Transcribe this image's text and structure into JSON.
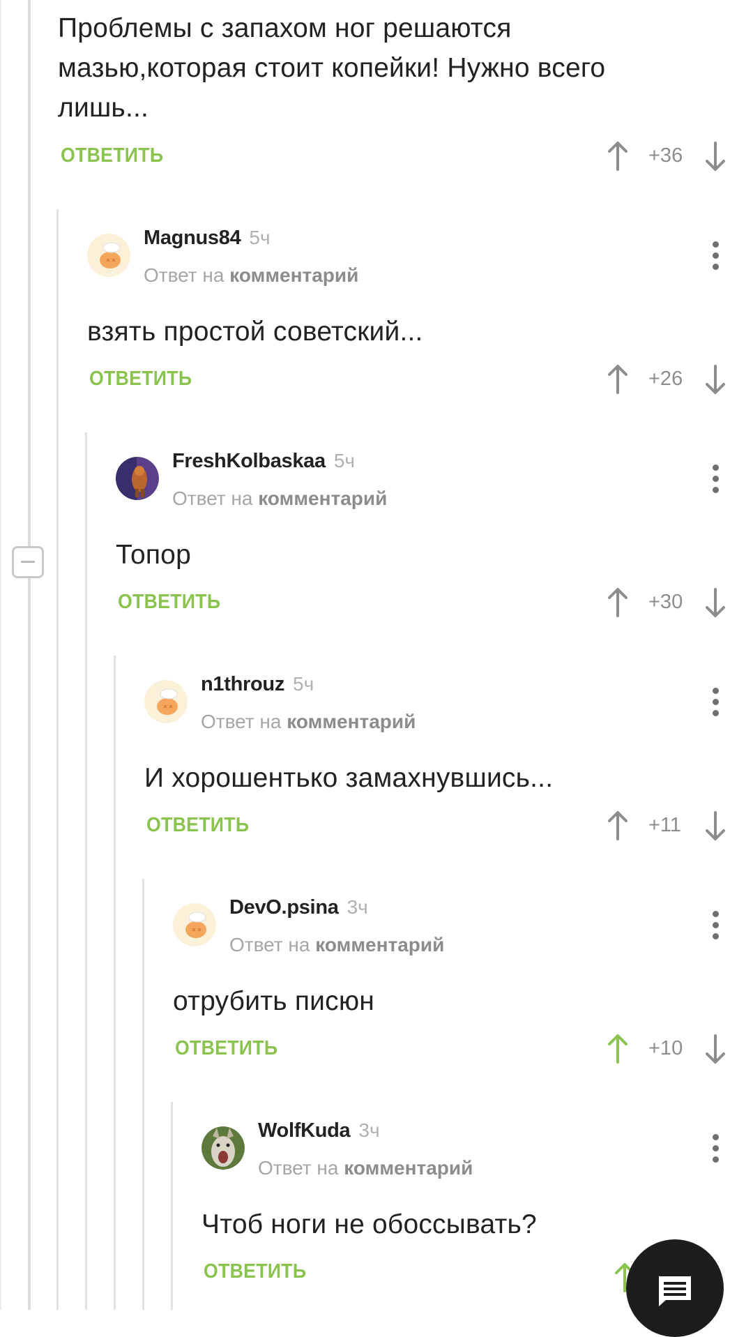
{
  "top": {
    "text": "Проблемы с запахом ног решаются мазью,которая стоит копейки! Нужно всего лишь...",
    "reply": "ОТВЕТИТЬ",
    "score": "+36"
  },
  "comments": [
    {
      "username": "Magnus84",
      "time": "5ч",
      "reply_prefix": "Ответ на",
      "reply_link": "комментарий",
      "text": "взять простой советский...",
      "reply": "ОТВЕТИТЬ",
      "score": "+26",
      "avatar": "default-chef-avatar"
    },
    {
      "username": "FreshKolbaskaa",
      "time": "5ч",
      "reply_prefix": "Ответ на",
      "reply_link": "комментарий",
      "text": "Топор",
      "reply": "ОТВЕТИТЬ",
      "score": "+30",
      "avatar": "cartoon-avatar"
    },
    {
      "username": "n1throuz",
      "time": "5ч",
      "reply_prefix": "Ответ на",
      "reply_link": "комментарий",
      "text": "И хорошентько замахнувшись...",
      "reply": "ОТВЕТИТЬ",
      "score": "+11",
      "avatar": "default-chef-avatar"
    },
    {
      "username": "DevO.psina",
      "time": "3ч",
      "reply_prefix": "Ответ на",
      "reply_link": "комментарий",
      "text": "отрубить писюн",
      "reply": "ОТВЕТИТЬ",
      "score": "+10",
      "upvoted": true,
      "avatar": "default-chef-avatar"
    },
    {
      "username": "WolfKuda",
      "time": "3ч",
      "reply_prefix": "Ответ на",
      "reply_link": "комментарий",
      "text": "Чтоб ноги не обоссывать?",
      "reply": "ОТВЕТИТЬ",
      "avatar": "wolf-avatar"
    }
  ],
  "colors": {
    "accent": "#8ac44f",
    "text": "#222222",
    "muted": "#a6a6a6",
    "fab": "#1d1d1d"
  },
  "icons": [
    "upvote-arrow-icon",
    "downvote-arrow-icon",
    "kebab-menu-icon",
    "collapse-icon",
    "comment-icon"
  ]
}
